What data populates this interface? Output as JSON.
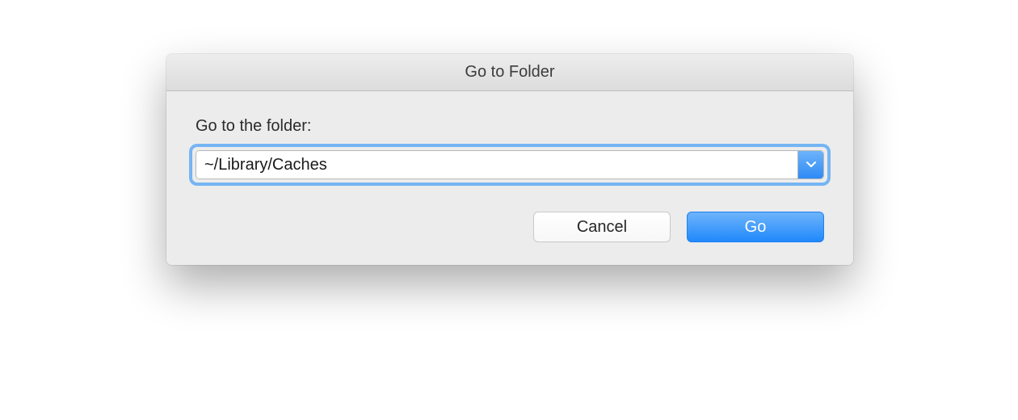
{
  "dialog": {
    "title": "Go to Folder",
    "label": "Go to the folder:",
    "path_value": "~/Library/Caches",
    "buttons": {
      "cancel": "Cancel",
      "go": "Go"
    }
  }
}
